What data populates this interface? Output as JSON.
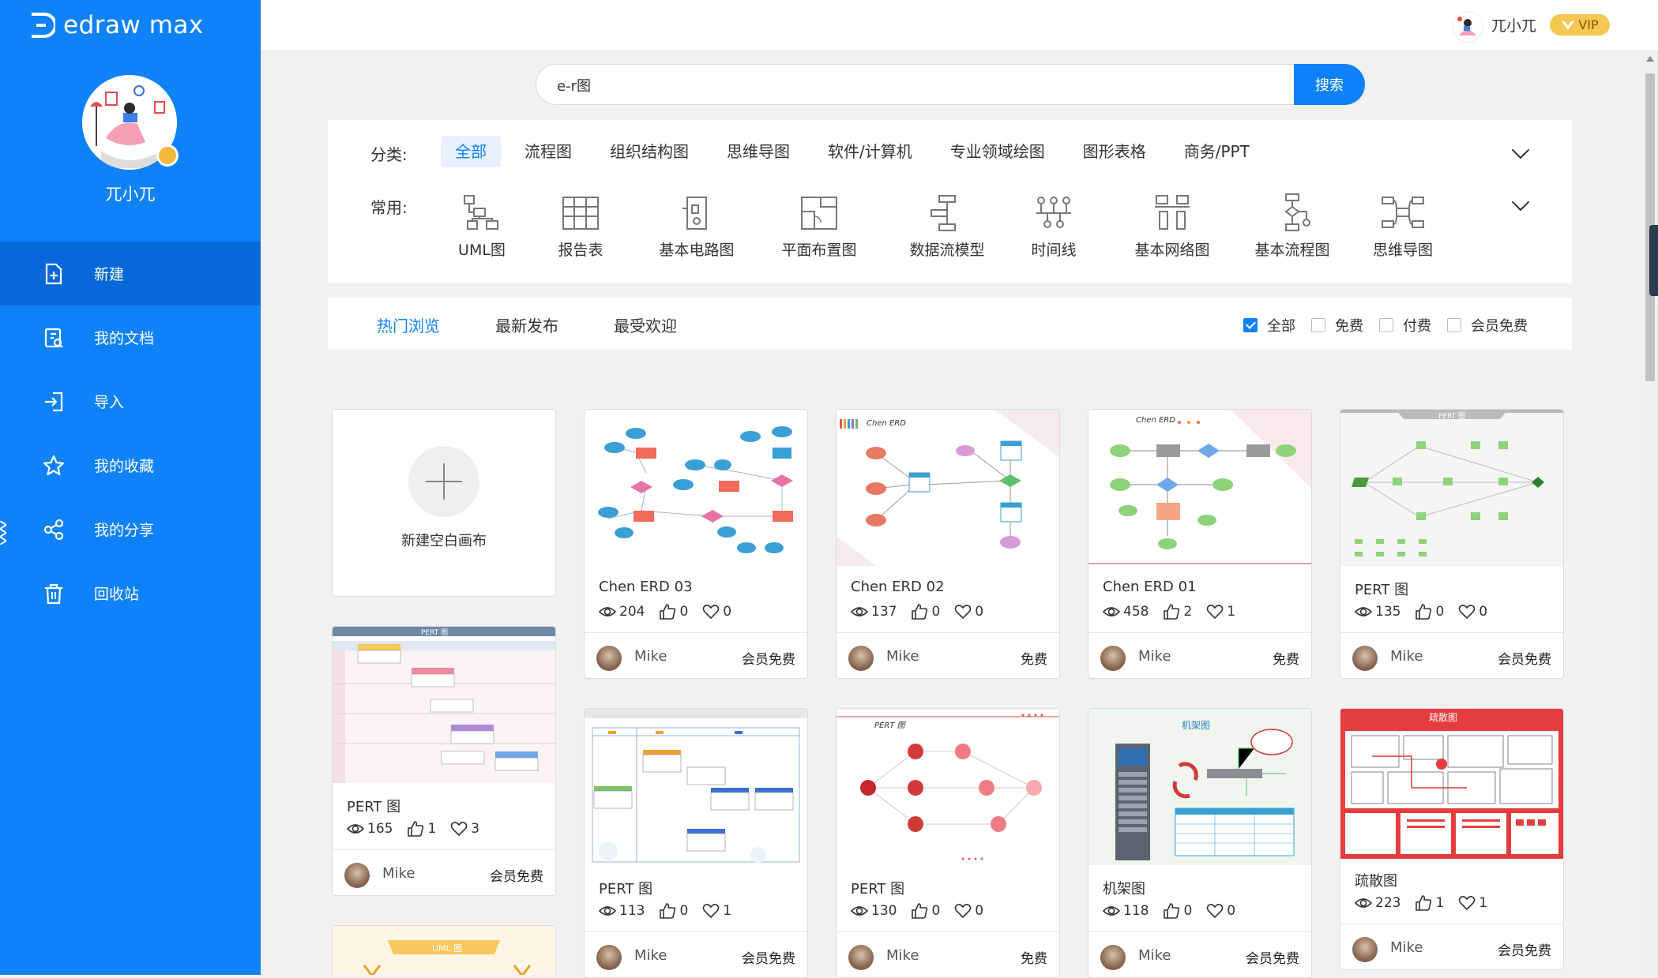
{
  "app": {
    "logo_text": "edraw max"
  },
  "sidebar": {
    "username": "兀小兀",
    "items": [
      {
        "label": "新建",
        "icon": "new-doc-icon",
        "active": true
      },
      {
        "label": "我的文档",
        "icon": "my-docs-icon"
      },
      {
        "label": "导入",
        "icon": "import-icon"
      },
      {
        "label": "我的收藏",
        "icon": "star-icon"
      },
      {
        "label": "我的分享",
        "icon": "share-icon"
      },
      {
        "label": "回收站",
        "icon": "trash-icon"
      }
    ]
  },
  "topbar": {
    "username": "兀小兀",
    "vip": "VIP"
  },
  "search": {
    "value": "e-r图",
    "button": "搜索"
  },
  "filter": {
    "category_label": "分类:",
    "categories": [
      "全部",
      "流程图",
      "组织结构图",
      "思维导图",
      "软件/计算机",
      "专业领域绘图",
      "图形表格",
      "商务/PPT"
    ],
    "common_label": "常用:",
    "common": [
      "UML图",
      "报告表",
      "基本电路图",
      "平面布置图",
      "数据流模型",
      "时间线",
      "基本网络图",
      "基本流程图",
      "思维导图"
    ]
  },
  "tabs": {
    "items": [
      "热门浏览",
      "最新发布",
      "最受欢迎"
    ],
    "checks": [
      {
        "label": "全部",
        "checked": true
      },
      {
        "label": "免费",
        "checked": false
      },
      {
        "label": "付费",
        "checked": false
      },
      {
        "label": "会员免费",
        "checked": false
      }
    ]
  },
  "new_blank": "新建空白画布",
  "cards": [
    {
      "title": "Chen ERD 03",
      "views": "204",
      "likes": "0",
      "favs": "0",
      "author": "Mike",
      "price": "会员免费",
      "thumb_text": ""
    },
    {
      "title": "Chen ERD 02",
      "views": "137",
      "likes": "0",
      "favs": "0",
      "author": "Mike",
      "price": "免费",
      "thumb_text": "Chen ERD"
    },
    {
      "title": "Chen ERD 01",
      "views": "458",
      "likes": "2",
      "favs": "1",
      "author": "Mike",
      "price": "免费",
      "thumb_text": "Chen ERD"
    },
    {
      "title": "PERT 图",
      "views": "135",
      "likes": "0",
      "favs": "0",
      "author": "Mike",
      "price": "会员免费",
      "thumb_text": "PERT 图"
    },
    {
      "title": "PERT 图",
      "views": "165",
      "likes": "1",
      "favs": "3",
      "author": "Mike",
      "price": "会员免费",
      "thumb_text": "PERT 图"
    },
    {
      "title": "PERT 图",
      "views": "113",
      "likes": "0",
      "favs": "1",
      "author": "Mike",
      "price": "会员免费",
      "thumb_text": ""
    },
    {
      "title": "PERT 图",
      "views": "130",
      "likes": "0",
      "favs": "0",
      "author": "Mike",
      "price": "免费",
      "thumb_text": "PERT 图"
    },
    {
      "title": "机架图",
      "views": "118",
      "likes": "0",
      "favs": "0",
      "author": "Mike",
      "price": "会员免费",
      "thumb_text": "机架图"
    },
    {
      "title": "疏散图",
      "views": "223",
      "likes": "1",
      "favs": "1",
      "author": "Mike",
      "price": "会员免费",
      "thumb_text": "疏散图"
    },
    {
      "title": "",
      "views": "",
      "likes": "",
      "favs": "",
      "author": "",
      "price": "",
      "thumb_text": "UML 图"
    }
  ],
  "colors": {
    "primary": "#0f82f9",
    "sidebar_active": "#0668d8",
    "vip_gold": "#f5c851"
  }
}
